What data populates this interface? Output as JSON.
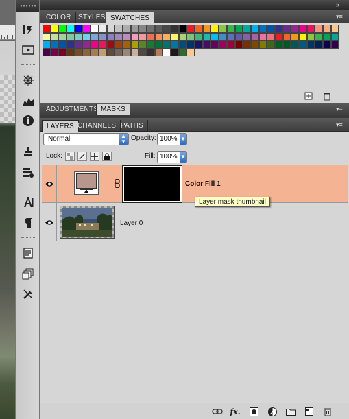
{
  "swatches_panel": {
    "tabs": [
      {
        "label": "COLOR",
        "active": false
      },
      {
        "label": "STYLES",
        "active": false
      },
      {
        "label": "SWATCHES",
        "active": true
      }
    ],
    "colors": [
      "#ff0000",
      "#ffff00",
      "#00ff00",
      "#00ffff",
      "#0000ff",
      "#ff00ff",
      "#ffffff",
      "#ebebeb",
      "#d6d6d6",
      "#c2c2c2",
      "#adadad",
      "#999999",
      "#858585",
      "#707070",
      "#5c5c5c",
      "#474747",
      "#333333",
      "#000000",
      "#ed1c24",
      "#f26522",
      "#f7941d",
      "#fff200",
      "#8dc63f",
      "#39b54a",
      "#00a651",
      "#00a99d",
      "#00aeef",
      "#0072bc",
      "#0054a6",
      "#2e3192",
      "#662d91",
      "#92278f",
      "#ec008c",
      "#ed145b",
      "#f7977a",
      "#fbad82",
      "#fdc68c",
      "#fff79a",
      "#c4df9b",
      "#a3d39c",
      "#82ca9c",
      "#7accc8",
      "#6dcff6",
      "#7da7d8",
      "#8493ca",
      "#8781bd",
      "#a186be",
      "#bd8cbf",
      "#f49ac1",
      "#f5989d",
      "#f26c4f",
      "#f68e56",
      "#fbaf5c",
      "#fff467",
      "#acd372",
      "#7cc576",
      "#3bb878",
      "#1abbb4",
      "#00bff3",
      "#438ccb",
      "#5574b9",
      "#605ca8",
      "#855fa8",
      "#a763a8",
      "#f06ea9",
      "#f26d7d",
      "#ed1c24",
      "#f26522",
      "#f7941d",
      "#fff200",
      "#8dc63f",
      "#39b54a",
      "#00a651",
      "#00a99d",
      "#00aeef",
      "#0072bc",
      "#0054a6",
      "#2e3192",
      "#662d91",
      "#92278f",
      "#ec008c",
      "#ed145b",
      "#9e0b0f",
      "#a0410d",
      "#a36209",
      "#aba000",
      "#598527",
      "#1a7b30",
      "#007236",
      "#00746b",
      "#0076a3",
      "#004b80",
      "#003471",
      "#1b1464",
      "#440e62",
      "#630460",
      "#9e005d",
      "#9e0039",
      "#790000",
      "#7b2e00",
      "#7d4900",
      "#827b00",
      "#406618",
      "#005e20",
      "#005826",
      "#005952",
      "#005b7f",
      "#003663",
      "#002157",
      "#0d004c",
      "#32004b",
      "#4b0049",
      "#7b0046",
      "#7a0026",
      "#603913",
      "#754c24",
      "#8c6239",
      "#a67c52",
      "#c69c6d",
      "#5e4b3c",
      "#736357",
      "#998675",
      "#c7b299",
      "#534741",
      "#362f2d",
      "#b97a57",
      "#ffffff",
      "#1a1a1a",
      "#2f6b2f",
      "#ffc88c"
    ],
    "footer_icons": [
      "new-swatch-icon",
      "trash-icon"
    ]
  },
  "middle_panel": {
    "tabs": [
      {
        "label": "ADJUSTMENTS",
        "active": false
      },
      {
        "label": "MASKS",
        "active": true
      }
    ]
  },
  "layers_panel": {
    "tabs": [
      {
        "label": "LAYERS",
        "active": true
      },
      {
        "label": "CHANNELS",
        "active": false
      },
      {
        "label": "PATHS",
        "active": false
      }
    ],
    "blend_mode": "Normal",
    "opacity_label": "Opacity:",
    "opacity_value": "100%",
    "lock_label": "Lock:",
    "fill_label": "Fill:",
    "fill_value": "100%",
    "layers": [
      {
        "name": "Color Fill 1",
        "visible": true,
        "selected": true,
        "fill_color": "#b8968c"
      },
      {
        "name": "Layer 0",
        "visible": true,
        "selected": false
      }
    ],
    "tooltip": "Layer mask thumbnail",
    "footer_icons": [
      "link-layers-icon",
      "fx-icon",
      "add-mask-icon",
      "adjustment-layer-icon",
      "new-group-icon",
      "new-layer-icon",
      "trash-icon"
    ],
    "fx_label": "fx."
  },
  "colors": {
    "selected_row": "#f4b393",
    "panel_bg": "#d6d6d6",
    "tab_bar": "#454545"
  }
}
